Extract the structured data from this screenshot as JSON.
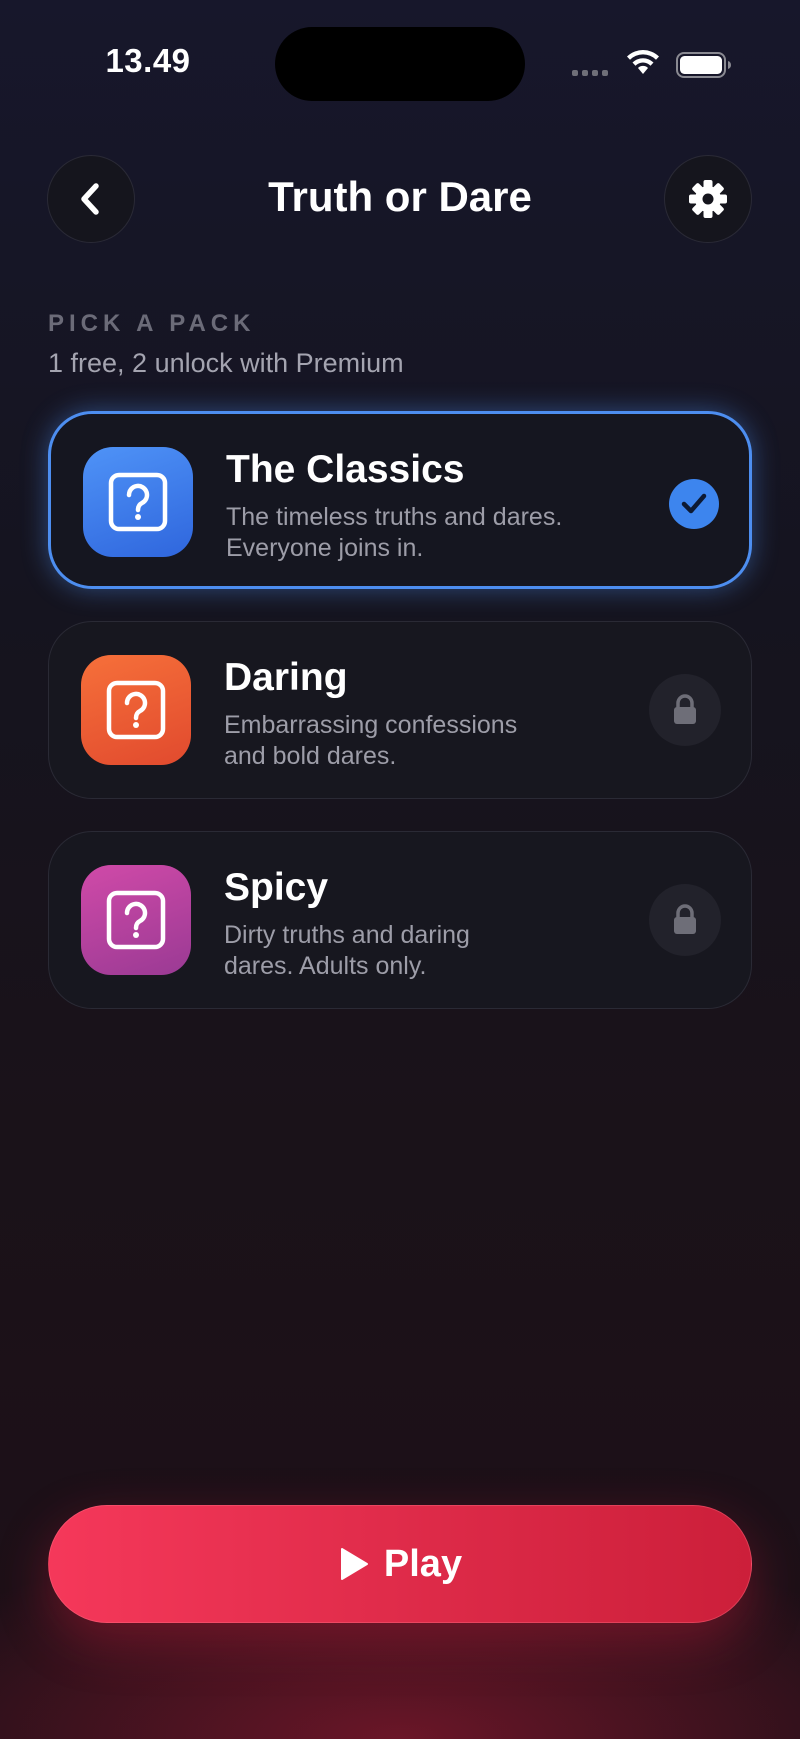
{
  "status_bar": {
    "time": "13.49"
  },
  "header": {
    "title": "Truth or Dare"
  },
  "section": {
    "label": "PICK A PACK",
    "subtitle": "1 free, 2 unlock with Premium"
  },
  "packs": [
    {
      "title": "The Classics",
      "description_line1": "The timeless truths and dares.",
      "description_line2": "Everyone joins in.",
      "selected": true,
      "locked": false,
      "icon": "question-square-icon",
      "color": "#3f7ff0"
    },
    {
      "title": "Daring",
      "description_line1": "Embarrassing confessions",
      "description_line2": "and bold dares.",
      "selected": false,
      "locked": true,
      "icon": "question-square-icon",
      "color": "#ef5a35"
    },
    {
      "title": "Spicy",
      "description_line1": "Dirty truths and daring",
      "description_line2": "dares. Adults only.",
      "selected": false,
      "locked": true,
      "icon": "question-square-icon",
      "color": "#c2409a"
    }
  ],
  "play_button": {
    "label": "Play"
  },
  "colors": {
    "accent": "#4d8ef0",
    "play": "#ef3454",
    "background": "#16151f"
  }
}
